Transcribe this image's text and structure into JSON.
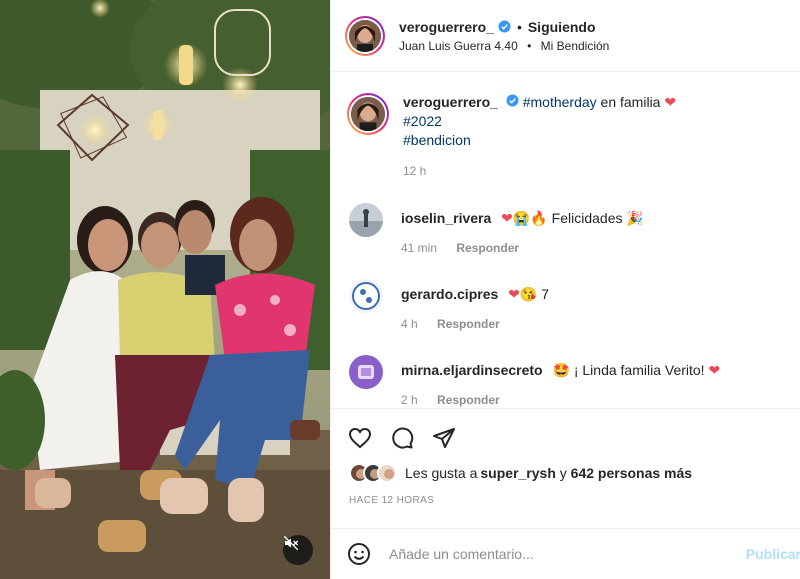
{
  "header": {
    "username": "veroguerrero_",
    "follow_state": "Siguiendo",
    "dot": "•",
    "audio_artist": "Juan Luis Guerra 4.40",
    "audio_track": "Mi Bendición"
  },
  "caption": {
    "username": "veroguerrero_",
    "hashtag1": "#motherday",
    "text": " en familia ",
    "hashtag2": "#2022",
    "hashtag3": "#bendicion",
    "time": "12 h"
  },
  "comments": [
    {
      "username": "ioselin_rivera",
      "text": "Felicidades",
      "time": "41 min",
      "reply": "Responder"
    },
    {
      "username": "gerardo.cipres",
      "text": "7",
      "time": "4 h",
      "reply": "Responder"
    },
    {
      "username": "mirna.eljardinsecreto",
      "text": "¡ Linda familia Verito!",
      "time": "2 h",
      "reply": "Responder"
    }
  ],
  "likes": {
    "prefix": "Les gusta a ",
    "user": "super_rysh",
    "joiner": " y ",
    "others": "642 personas más"
  },
  "timestamp": "HACE 12 HORAS",
  "add_comment": {
    "placeholder": "Añade un comentario...",
    "post_label": "Publicar"
  },
  "icons": {
    "like": "heart-icon",
    "comment": "comment-icon",
    "share": "share-icon",
    "emoji": "emoji-icon",
    "mute": "mute-icon",
    "verified": "verified-badge-icon"
  },
  "colors": {
    "hashtag": "#00376b",
    "verified": "#3897f0",
    "muted": "#8e8e8e",
    "post_button": "#b2dffc",
    "heart": "#ed4956"
  }
}
